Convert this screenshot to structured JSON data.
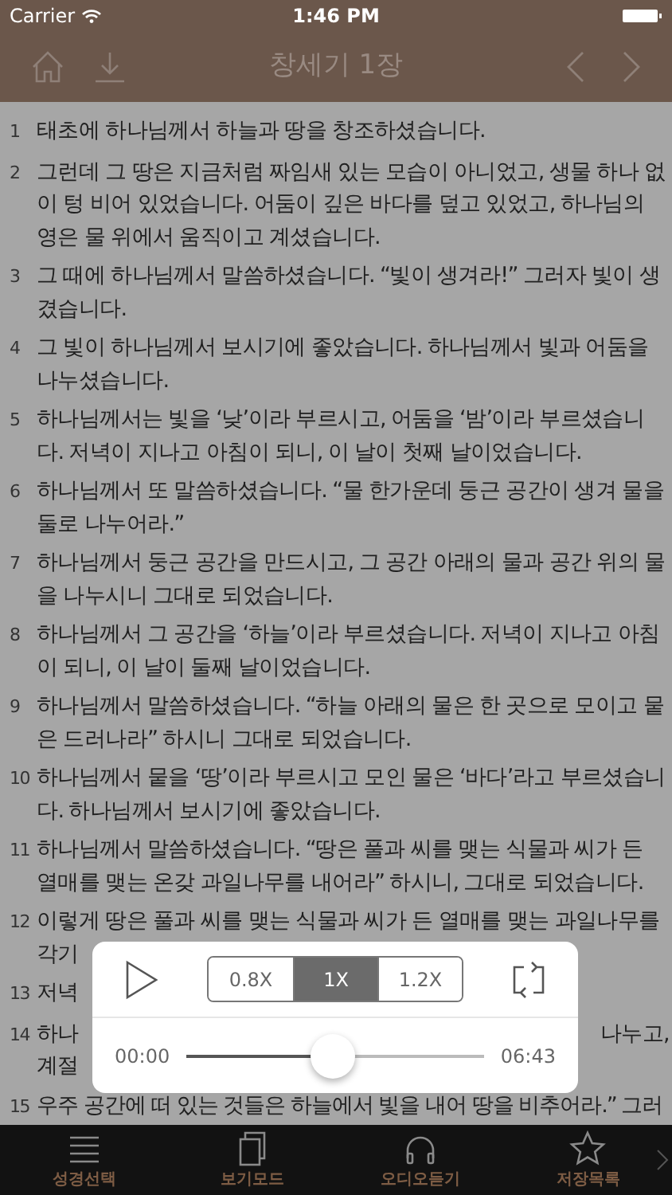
{
  "status_bar": {
    "carrier": "Carrier",
    "time": "1:46 PM"
  },
  "nav": {
    "title": "창세기 1장"
  },
  "verses": [
    {
      "kind": "full",
      "number": "1",
      "text": "태초에 하나님께서 하늘과 땅을 창조하셨습니다."
    },
    {
      "kind": "full",
      "number": "2",
      "text": "그런데 그 땅은 지금처럼 짜임새 있는 모습이 아니었고, 생물 하나 없이 텅 비어 있었습니다. 어둠이 깊은 바다를 덮고 있었고, 하나님의 영은 물 위에서 움직이고 계셨습니다."
    },
    {
      "kind": "full",
      "number": "3",
      "text": "그 때에 하나님께서 말씀하셨습니다. “빛이 생겨라!” 그러자 빛이 생겼습니다."
    },
    {
      "kind": "full",
      "number": "4",
      "text": "그 빛이 하나님께서 보시기에 좋았습니다. 하나님께서 빛과 어둠을 나누셨습니다."
    },
    {
      "kind": "full",
      "number": "5",
      "text": "하나님께서는 빛을 ‘낮’이라 부르시고, 어둠을 ‘밤’이라 부르셨습니다. 저녁이 지나고 아침이 되니, 이 날이 첫째 날이었습니다."
    },
    {
      "kind": "full",
      "number": "6",
      "text": "하나님께서 또 말씀하셨습니다. “물 한가운데 둥근 공간이 생겨 물을 둘로 나누어라.”"
    },
    {
      "kind": "full",
      "number": "7",
      "text": "하나님께서 둥근 공간을 만드시고, 그 공간 아래의 물과 공간 위의 물을 나누시니 그대로 되었습니다."
    },
    {
      "kind": "full",
      "number": "8",
      "text": "하나님께서 그 공간을 ‘하늘’이라 부르셨습니다. 저녁이 지나고 아침이 되니, 이 날이 둘째 날이었습니다."
    },
    {
      "kind": "full",
      "number": "9",
      "text": "하나님께서 말씀하셨습니다. “하늘 아래의 물은 한 곳으로 모이고 뭍은 드러나라” 하시니 그대로 되었습니다."
    },
    {
      "kind": "full",
      "number": "10",
      "text": "하나님께서 뭍을 ‘땅’이라 부르시고 모인 물은 ‘바다’라고 부르셨습니다. 하나님께서 보시기에 좋았습니다."
    },
    {
      "kind": "full",
      "number": "11",
      "text": "하나님께서 말씀하셨습니다. “땅은 풀과 씨를 맺는 식물과 씨가 든 열매를 맺는 온갖 과일나무를 내어라” 하시니, 그대로 되었습니다."
    },
    {
      "kind": "covered",
      "number": "12",
      "lines": [
        {
          "left": "이렇게 땅은 풀과 씨를 맺는 식물과 씨가 든 열매를 맺는 과일나무를"
        },
        {
          "left": "각기"
        }
      ]
    },
    {
      "kind": "covered",
      "number": "13",
      "lines": [
        {
          "left": "저녁"
        }
      ]
    },
    {
      "kind": "covered",
      "number": "14",
      "lines": [
        {
          "left": "하나",
          "right": "나누고,"
        },
        {
          "left": "계절"
        }
      ]
    },
    {
      "kind": "line",
      "number": "15",
      "text": "우주 공간에 떠 있는 것들은 하늘에서 빛을 내어 땅을 비추어라.” 그러"
    }
  ],
  "player": {
    "speeds": [
      {
        "label": "0.8X",
        "selected": false
      },
      {
        "label": "1X",
        "selected": true
      },
      {
        "label": "1.2X",
        "selected": false
      }
    ],
    "elapsed": "00:00",
    "total": "06:43",
    "level": 0.49
  },
  "tab_bar": [
    {
      "kind": "list",
      "label": "성경선택"
    },
    {
      "kind": "pages",
      "label": "보기모드"
    },
    {
      "kind": "headphones",
      "label": "오디오듣기"
    },
    {
      "kind": "star",
      "label": "저장목록"
    }
  ]
}
